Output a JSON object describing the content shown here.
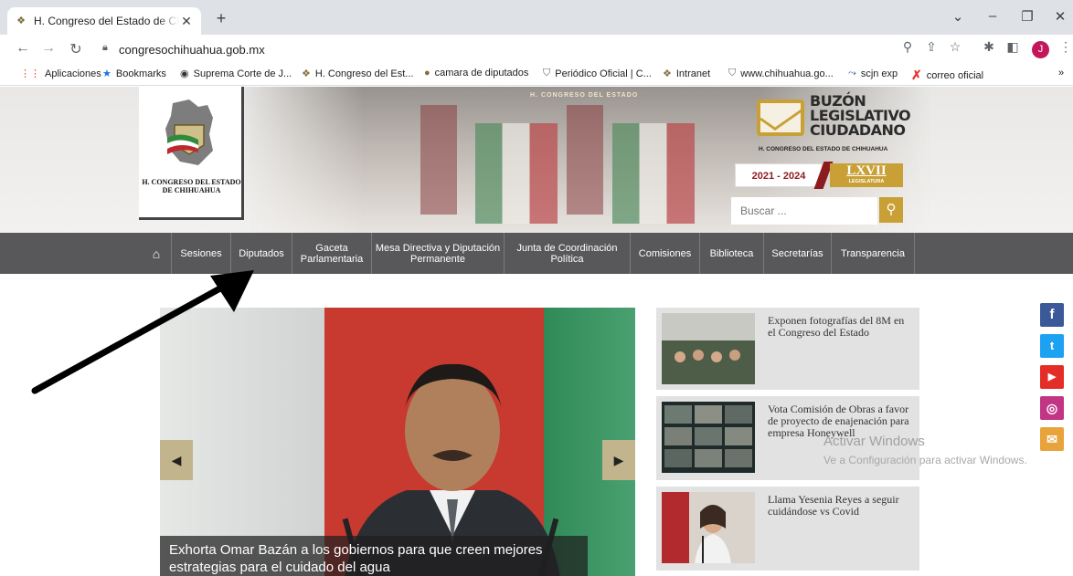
{
  "browser": {
    "tab_title": "H. Congreso del Estado de Chihuahua",
    "url": "congresochihuahua.gob.mx",
    "profile_initial": "J",
    "bookmarks": [
      {
        "label": "Aplicaciones",
        "icon": "apps-grid-icon"
      },
      {
        "label": "Bookmarks",
        "icon": "star-icon"
      },
      {
        "label": "Suprema Corte de J...",
        "icon": "globe-icon"
      },
      {
        "label": "H. Congreso del Est...",
        "icon": "congreso-favicon"
      },
      {
        "label": "camara de diputados",
        "icon": "camara-favicon"
      },
      {
        "label": "Periódico Oficial | C...",
        "icon": "shield-favicon"
      },
      {
        "label": "Intranet",
        "icon": "congreso-favicon"
      },
      {
        "label": "www.chihuahua.go...",
        "icon": "shield-favicon"
      },
      {
        "label": "scjn exp",
        "icon": "scjn-favicon"
      },
      {
        "label": "correo oficial",
        "icon": "red-x-icon"
      }
    ],
    "more_bookmarks": "»"
  },
  "header": {
    "chamber_text": "H. CONGRESO DEL ESTADO",
    "logo_caption_1": "H. CONGRESO DEL ESTADO",
    "logo_caption_2": "DE CHIHUAHUA",
    "buzon_1": "BUZÓN",
    "buzon_2": "LEGISLATIVO",
    "buzon_3": "CIUDADANO",
    "buzon_sub": "H. CONGRESO DEL ESTADO DE CHIHUAHUA",
    "years": "2021 - 2024",
    "legislature_number": "LXVII",
    "legislature_label": "LEGISLATURA",
    "search_placeholder": "Buscar ..."
  },
  "menu": {
    "items": [
      {
        "label": "Sesiones"
      },
      {
        "label": "Diputados"
      },
      {
        "label": "Gaceta Parlamentaria"
      },
      {
        "label": "Mesa Directiva y Diputación Permanente"
      },
      {
        "label": "Junta de Coordinación Política"
      },
      {
        "label": "Comisiones"
      },
      {
        "label": "Biblioteca"
      },
      {
        "label": "Secretarías"
      },
      {
        "label": "Transparencia"
      }
    ]
  },
  "slider": {
    "caption": "Exhorta Omar Bazán a los gobiernos para que creen mejores estrategias para el cuidado del agua"
  },
  "news": [
    {
      "title": "Exponen fotografías del 8M en el Congreso del Estado"
    },
    {
      "title": "Vota Comisión de Obras a favor de proyecto de enajenación para empresa Honeywell"
    },
    {
      "title": "Llama Yesenia Reyes a seguir cuidándose vs Covid"
    }
  ],
  "social": [
    {
      "label": "f",
      "color": "#3b5998"
    },
    {
      "label": "t",
      "color": "#1da1f2"
    },
    {
      "label": "▶",
      "color": "#e52d27"
    },
    {
      "label": "◎",
      "color": "#c13584"
    },
    {
      "label": "✉",
      "color": "#e8a33a"
    }
  ],
  "os_watermark": {
    "line1": "Activar Windows",
    "line2": "Ve a Configuración para activar Windows."
  }
}
